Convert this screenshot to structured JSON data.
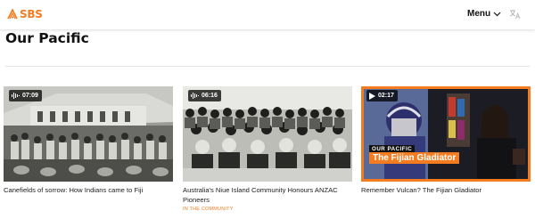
{
  "header": {
    "logo_text": "SBS",
    "menu_label": "Menu"
  },
  "page": {
    "title": "Our Pacific"
  },
  "cards": [
    {
      "duration": "07:09",
      "badge_icon": "audio-bars-icon",
      "title": "Canefields of sorrow: How Indians came to Fiji",
      "tag": ""
    },
    {
      "duration": "06:16",
      "badge_icon": "audio-bars-icon",
      "title": "Australia's Niue Island Community Honours ANZAC Pioneers",
      "tag": "IN THE COMMUNITY"
    },
    {
      "duration": "02:17",
      "badge_icon": "play-icon",
      "title": "Remember Vulcan? The Fijian Gladiator",
      "tag": "",
      "overlay_kicker": "OUR PACIFIC",
      "overlay_title": "The Fijian Gladiator"
    }
  ],
  "colors": {
    "accent": "#f47c20",
    "text": "#1a1a1a",
    "divider": "#e3e3e3"
  }
}
